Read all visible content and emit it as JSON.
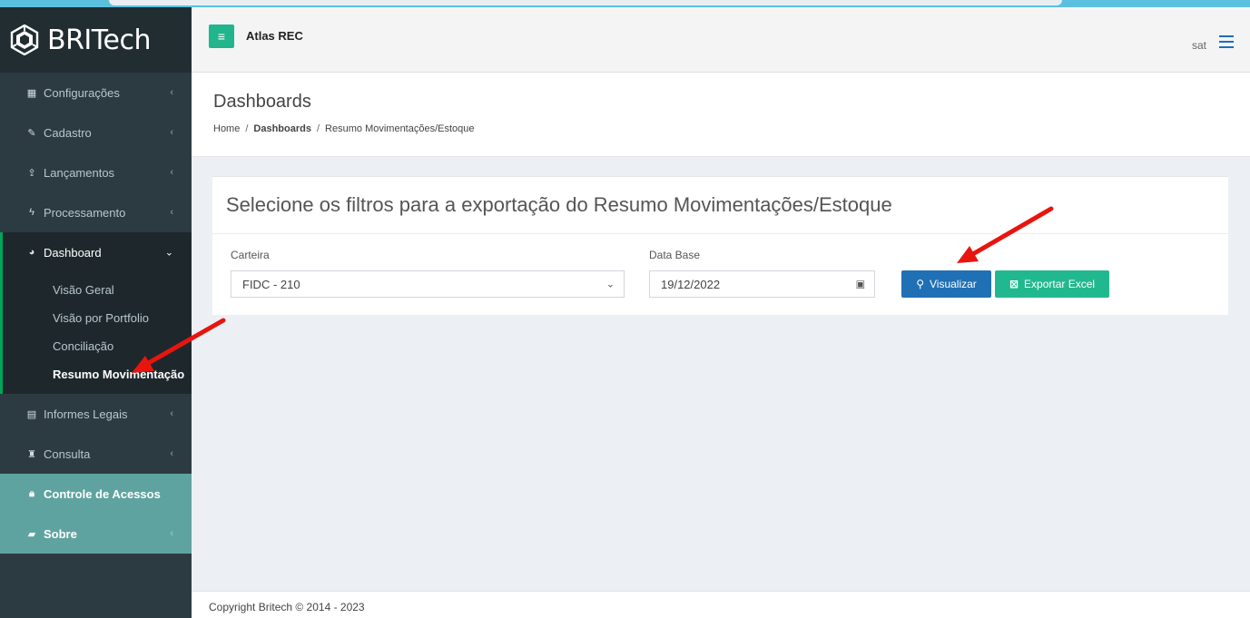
{
  "brand": {
    "name": "BRITech"
  },
  "header": {
    "app_title": "Atlas REC",
    "user": "sat"
  },
  "sidebar": {
    "items": [
      {
        "label": "Configurações",
        "icon": "grid-icon"
      },
      {
        "label": "Cadastro",
        "icon": "edit-icon"
      },
      {
        "label": "Lançamentos",
        "icon": "upload-icon"
      },
      {
        "label": "Processamento",
        "icon": "bolt-icon"
      },
      {
        "label": "Dashboard",
        "icon": "pie-chart-icon"
      },
      {
        "label": "Informes Legais",
        "icon": "building-icon"
      },
      {
        "label": "Consulta",
        "icon": "binoculars-icon"
      },
      {
        "label": "Controle de Acessos",
        "icon": "lock-icon"
      },
      {
        "label": "Sobre",
        "icon": "book-icon"
      }
    ],
    "dashboard_sub": [
      "Visão Geral",
      "Visão por Portfolio",
      "Conciliação",
      "Resumo Movimentação"
    ]
  },
  "page": {
    "title": "Dashboards",
    "breadcrumb": {
      "home": "Home",
      "section": "Dashboards",
      "current": "Resumo Movimentações/Estoque"
    }
  },
  "filters": {
    "heading": "Selecione os filtros para a exportação do Resumo Movimentações/Estoque",
    "carteira_label": "Carteira",
    "carteira_value": "FIDC - 210",
    "data_base_label": "Data Base",
    "data_base_value": "19/12/2022",
    "visualizar_label": "Visualizar",
    "exportar_label": "Exportar Excel"
  },
  "footer": {
    "text": "Copyright Britech © 2014 - 2023"
  },
  "colors": {
    "accent": "#20b58c",
    "primary": "#1f70b5",
    "sidebar": "#2c3b41",
    "arrow": "#e8150f"
  }
}
